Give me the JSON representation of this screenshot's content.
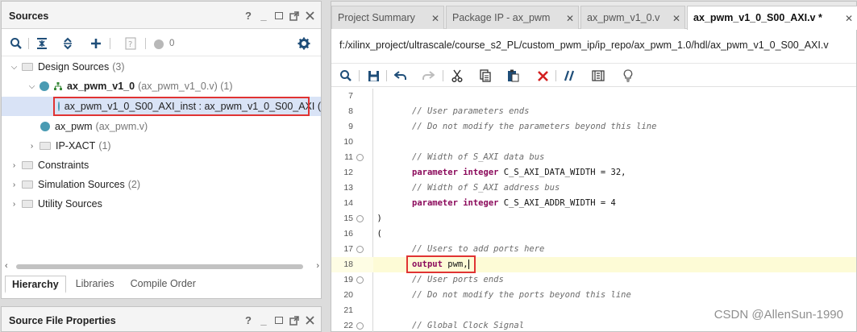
{
  "sources": {
    "title": "Sources",
    "ctrl_help": "?",
    "ctrl_min": "_",
    "count": "0",
    "tree": {
      "design_sources": {
        "label": "Design Sources",
        "meta": "(3)"
      },
      "ax_pwm_v1_0": {
        "label": "ax_pwm_v1_0",
        "meta": "(ax_pwm_v1_0.v) (1)"
      },
      "inst": {
        "label": "ax_pwm_v1_0_S00_AXI_inst : ax_pwm_v1_0_S00_AXI ("
      },
      "ax_pwm": {
        "label": "ax_pwm",
        "meta": "(ax_pwm.v)"
      },
      "ip_xact": {
        "label": "IP-XACT",
        "meta": "(1)"
      },
      "constraints": {
        "label": "Constraints"
      },
      "simulation_sources": {
        "label": "Simulation Sources",
        "meta": "(2)"
      },
      "utility_sources": {
        "label": "Utility Sources"
      }
    },
    "tabs": [
      "Hierarchy",
      "Libraries",
      "Compile Order"
    ]
  },
  "props": {
    "title": "Source File Properties",
    "ctrl_help": "?",
    "ctrl_min": "_"
  },
  "editor": {
    "tabs": [
      "Project Summary",
      "Package IP - ax_pwm",
      "ax_pwm_v1_0.v",
      "ax_pwm_v1_0_S00_AXI.v *"
    ],
    "path": "f:/xilinx_project/ultrascale/course_s2_PL/custom_pwm_ip/ip_repo/ax_pwm_1.0/hdl/ax_pwm_v1_0_S00_AXI.v",
    "lines": [
      {
        "n": "7",
        "parts": []
      },
      {
        "n": "8",
        "parts": [
          [
            "cm",
            "// User parameters ends"
          ]
        ]
      },
      {
        "n": "9",
        "parts": [
          [
            "cm",
            "// Do not modify the parameters beyond this line"
          ]
        ]
      },
      {
        "n": "10",
        "parts": []
      },
      {
        "n": "11",
        "fold": true,
        "parts": [
          [
            "cm",
            "// Width of S_AXI data bus"
          ]
        ]
      },
      {
        "n": "12",
        "parts": [
          [
            "kw",
            "parameter integer"
          ],
          [
            "id",
            " C_S_AXI_DATA_WIDTH = 32,"
          ]
        ]
      },
      {
        "n": "13",
        "parts": [
          [
            "cm",
            "// Width of S_AXI address bus"
          ]
        ]
      },
      {
        "n": "14",
        "parts": [
          [
            "kw",
            "parameter integer"
          ],
          [
            "id",
            " C_S_AXI_ADDR_WIDTH = 4"
          ]
        ]
      },
      {
        "n": "15",
        "fold": true,
        "indent": -3,
        "parts": [
          [
            "id",
            ")"
          ]
        ]
      },
      {
        "n": "16",
        "indent": -3,
        "parts": [
          [
            "id",
            "("
          ]
        ]
      },
      {
        "n": "17",
        "fold": true,
        "parts": [
          [
            "cm",
            "// Users to add ports here"
          ]
        ]
      },
      {
        "n": "18",
        "current": true,
        "parts": [
          [
            "kw",
            "output"
          ],
          [
            "id",
            " pwm,"
          ]
        ]
      },
      {
        "n": "19",
        "fold": true,
        "parts": [
          [
            "cm",
            "// User ports ends"
          ]
        ]
      },
      {
        "n": "20",
        "parts": [
          [
            "cm",
            "// Do not modify the ports beyond this line"
          ]
        ]
      },
      {
        "n": "21",
        "parts": []
      },
      {
        "n": "22",
        "fold": true,
        "parts": [
          [
            "cm",
            "// Global Clock Signal"
          ]
        ]
      }
    ]
  },
  "watermark": "CSDN @AllenSun-1990"
}
